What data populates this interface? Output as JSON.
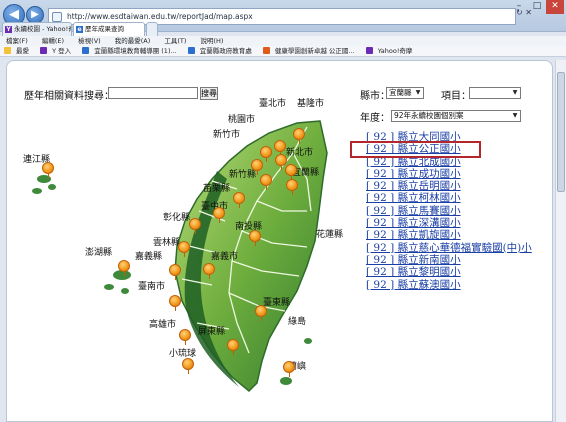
{
  "browser": {
    "address": "http://www.esdtaiwan.edu.tw/reportJad/map.aspx",
    "tabs": [
      {
        "label": "永續校園 - Yahoo!奇摩 搜尋結果",
        "icon": "Y"
      },
      {
        "label": "歷年成果查詢",
        "icon": "e"
      }
    ],
    "menu": [
      "檔案(F)",
      "編輯(E)",
      "檢視(V)",
      "我的最愛(A)",
      "工具(T)",
      "說明(H)"
    ],
    "favorites": [
      "最愛",
      "Y 登入",
      "宜蘭縣環境教育輔導團 (1)...",
      "宜蘭縣政府教育處",
      "健康學園創新卓越 公正國...",
      "Yahoo!奇摩"
    ]
  },
  "search": {
    "label": "歷年相關資料搜尋：",
    "value": "",
    "button": "搜尋"
  },
  "filters": {
    "county_label": "縣市：",
    "county_value": "宜蘭縣",
    "item_label": "項目：",
    "item_value": "",
    "year_label": "年度：",
    "year_value": "92年永續校園個別案"
  },
  "schools": [
    "[ 92 ] 縣立大同國小",
    "[ 92 ] 縣立公正國小",
    "[ 92 ] 縣立北成國小",
    "[ 92 ] 縣立成功國小",
    "[ 92 ] 縣立岳明國小",
    "[ 92 ] 縣立柯林國小",
    "[ 92 ] 縣立馬賽國小",
    "[ 92 ] 縣立深溝國小",
    "[ 92 ] 縣立凱旋國小",
    "[ 92 ] 縣立慈心華德福實驗國(中)小",
    "[ 92 ] 縣立新南國小",
    "[ 92 ] 縣立黎明國小",
    "[ 92 ] 縣立蘇澳國小"
  ],
  "map_labels": [
    "臺北市",
    "基隆市",
    "桃園市",
    "新竹市",
    "新北市",
    "連江縣",
    "新竹縣",
    "宜蘭縣",
    "苗栗縣",
    "臺中市",
    "彰化縣",
    "南投縣",
    "花蓮縣",
    "雲林縣",
    "澎湖縣",
    "嘉義縣",
    "嘉義市",
    "臺南市",
    "臺東縣",
    "高雄市",
    "屏東縣",
    "綠島",
    "小琉球",
    "蘭嶼"
  ],
  "colors": {
    "pin": "#f29a1e",
    "map_dark": "#2f7d32",
    "map_light": "#8cc34a",
    "link": "#1a3fa6",
    "highlight": "#b3262b"
  }
}
